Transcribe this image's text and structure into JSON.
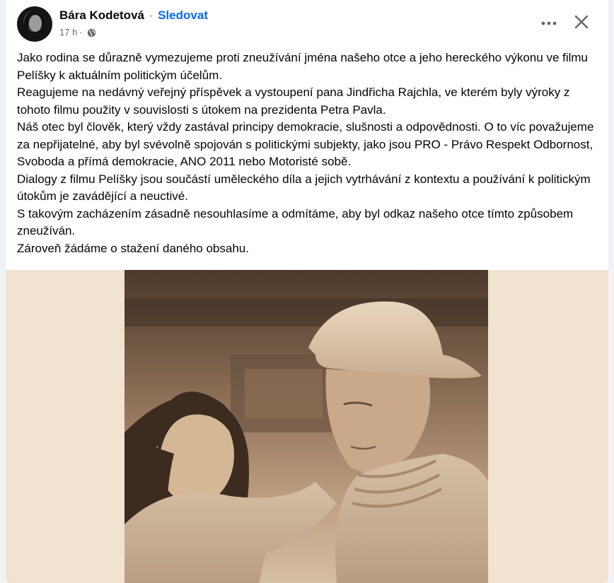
{
  "post": {
    "author_name": "Bára Kodetová",
    "separator": "·",
    "follow_label": "Sledovat",
    "time": "17 h",
    "time_separator": "·",
    "privacy_icon": "globe-icon",
    "more_icon": "more-options-icon",
    "close_icon": "close-icon",
    "paragraphs": [
      "Jako rodina se důrazně vymezujeme proti zneužívání jména našeho otce a jeho hereckého výkonu ve filmu Pelíšky k aktuálním politickým účelům.",
      "Reagujeme na nedávný veřejný příspěvek a vystoupení pana Jindřicha Rajchla, ve kterém byly výroky z tohoto filmu použity v souvislosti s útokem na prezidenta Petra Pavla.",
      "Náš otec byl člověk, který vždy zastával principy demokracie, slušnosti a odpovědnosti. O to víc považujeme za nepřijatelné, aby byl svévolně spojován s politickými subjekty, jako jsou PRO - Právo Respekt Odbornost, Svoboda a přímá demokracie, ANO 2011 nebo Motoristé sobě.",
      "Dialogy z filmu Pelíšky jsou součástí uměleckého díla a jejich vytrhávání z kontextu a používání k politickým útokům je zavádějící a neuctivé.",
      "S takovým zacházením zásadně nesouhlasíme a odmítáme, aby byl odkaz našeho otce tímto způsobem zneužíván.",
      "Zároveň žádáme o stažení daného obsahu."
    ]
  },
  "colors": {
    "link": "#0866ff",
    "text": "#050505",
    "secondary": "#65676b",
    "photo_background": "#f2e2d0",
    "sepia": "#c9a98a"
  }
}
